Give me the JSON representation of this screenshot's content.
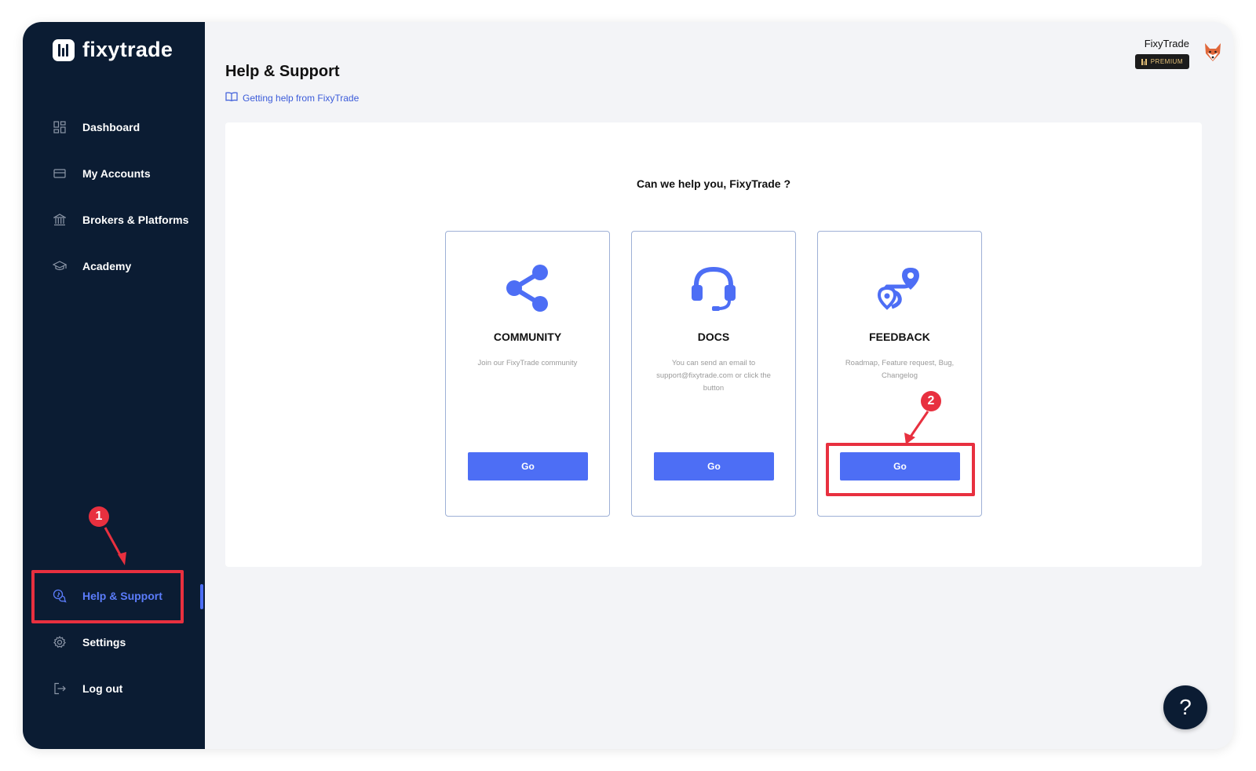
{
  "app": {
    "logo_text": "fixytrade"
  },
  "sidebar": {
    "items": [
      {
        "label": "Dashboard",
        "icon": "dashboard-icon"
      },
      {
        "label": "My Accounts",
        "icon": "card-icon"
      },
      {
        "label": "Brokers & Platforms",
        "icon": "bank-icon"
      },
      {
        "label": "Academy",
        "icon": "graduation-cap-icon"
      }
    ],
    "bottom_items": [
      {
        "label": "Help & Support",
        "icon": "help-chat-icon",
        "active": true
      },
      {
        "label": "Settings",
        "icon": "gear-icon"
      },
      {
        "label": "Log out",
        "icon": "logout-icon"
      }
    ]
  },
  "header": {
    "title": "Help & Support",
    "help_link": "Getting help from FixyTrade",
    "user_name": "FixyTrade",
    "badge": "PREMIUM"
  },
  "content": {
    "question": "Can we help you, FixyTrade ?",
    "cards": [
      {
        "title": "COMMUNITY",
        "description": "Join our FixyTrade community",
        "button": "Go",
        "icon": "share-icon"
      },
      {
        "title": "DOCS",
        "description": "You can send an email to support@fixytrade.com or click the button",
        "button": "Go",
        "icon": "headset-icon"
      },
      {
        "title": "FEEDBACK",
        "description": "Roadmap, Feature request, Bug, Changelog",
        "button": "Go",
        "icon": "route-map-icon"
      }
    ]
  },
  "annotations": [
    {
      "number": "1"
    },
    {
      "number": "2"
    }
  ],
  "help_fab": "?",
  "colors": {
    "sidebar_bg": "#0b1c33",
    "accent": "#4d6ef5",
    "annotation": "#e8303f"
  }
}
